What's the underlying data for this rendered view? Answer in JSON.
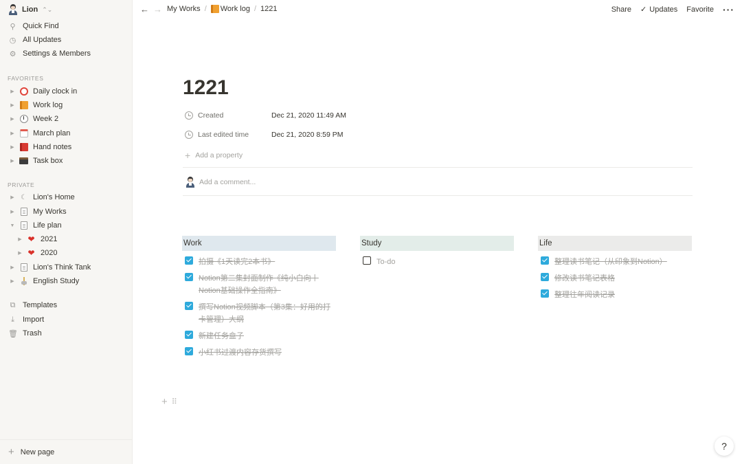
{
  "sidebar": {
    "workspace": "Lion",
    "nav": [
      {
        "label": "Quick Find",
        "icon": "search-icon"
      },
      {
        "label": "All Updates",
        "icon": "clock-icon"
      },
      {
        "label": "Settings & Members",
        "icon": "gear-icon"
      }
    ],
    "favorites_label": "FAVORITES",
    "favorites": [
      {
        "label": "Daily clock in",
        "icon": "alarm-clock-icon"
      },
      {
        "label": "Work log",
        "icon": "orange-book-icon"
      },
      {
        "label": "Week 2",
        "icon": "clock-icon"
      },
      {
        "label": "March plan",
        "icon": "calendar-icon"
      },
      {
        "label": "Hand notes",
        "icon": "red-book-icon"
      },
      {
        "label": "Task box",
        "icon": "box-icon"
      }
    ],
    "private_label": "PRIVATE",
    "private": [
      {
        "label": "Lion's Home",
        "icon": "moon-icon"
      },
      {
        "label": "My Works",
        "icon": "document-icon"
      },
      {
        "label": "Life plan",
        "icon": "document-icon"
      },
      {
        "label": "2021",
        "icon": "heart-icon"
      },
      {
        "label": "2020",
        "icon": "heart-icon"
      },
      {
        "label": "Lion's Think Tank",
        "icon": "document-icon"
      },
      {
        "label": "English Study",
        "icon": "flag-icon"
      }
    ],
    "bottom": [
      {
        "label": "Templates",
        "icon": "templates-icon"
      },
      {
        "label": "Import",
        "icon": "import-icon"
      },
      {
        "label": "Trash",
        "icon": "trash-icon"
      }
    ],
    "new_page": "New page"
  },
  "topbar": {
    "breadcrumb": [
      "My Works",
      "Work log",
      "1221"
    ],
    "share": "Share",
    "updates": "Updates",
    "favorite": "Favorite"
  },
  "page": {
    "title": "1221",
    "properties": [
      {
        "name": "Created",
        "value": "Dec 21, 2020 11:49 AM"
      },
      {
        "name": "Last edited time",
        "value": "Dec 21, 2020 8:59 PM"
      }
    ],
    "add_property": "Add a property",
    "add_comment": "Add a comment..."
  },
  "columns": [
    {
      "heading": "Work",
      "color": "#dfe8ee",
      "todos": [
        {
          "text": "拍摄《1天读完2本书》",
          "checked": true
        },
        {
          "text": "Notion第二集封面制作《纯小白向丨Notion基础操作全指南》",
          "checked": true
        },
        {
          "text": "撰写Notion视频脚本（第3集：好用的打卡管理）大纲",
          "checked": true
        },
        {
          "text": "新建任务盒子",
          "checked": true
        },
        {
          "text": "小红书过渡内容存货撰写",
          "checked": true
        }
      ]
    },
    {
      "heading": "Study",
      "color": "#e3ede9",
      "todos": [
        {
          "text": "To-do",
          "checked": false
        }
      ]
    },
    {
      "heading": "Life",
      "color": "#ebebea",
      "todos": [
        {
          "text": "整理读书笔记（从印象到Notion）",
          "checked": true
        },
        {
          "text": "修改读书笔记表格",
          "checked": true
        },
        {
          "text": "整理往年阅读记录",
          "checked": true
        }
      ]
    }
  ],
  "help": "?",
  "accent_color": "#2eaadc"
}
